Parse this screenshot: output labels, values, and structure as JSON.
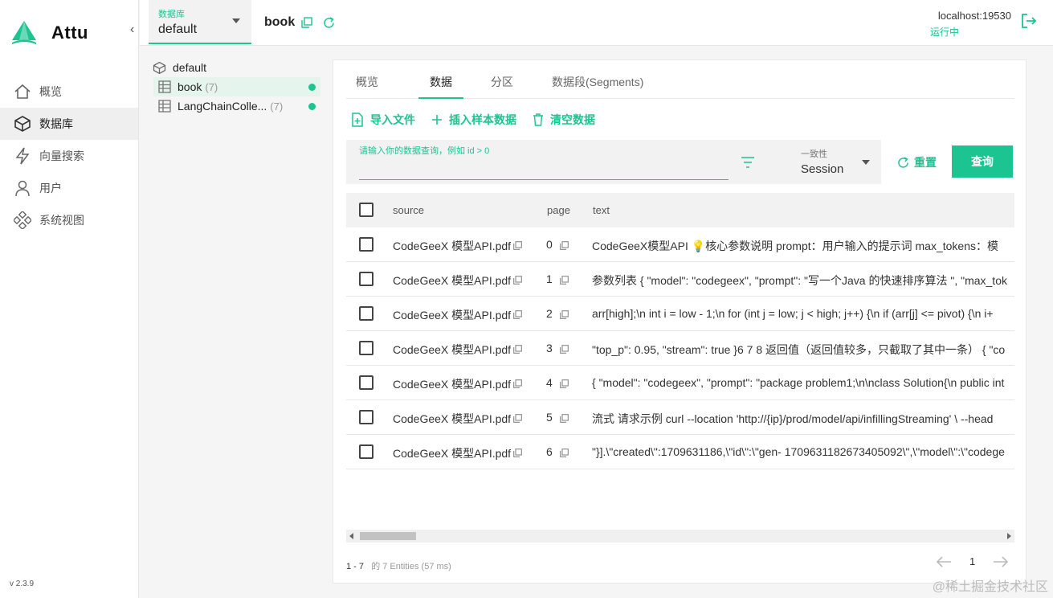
{
  "app": {
    "name": "Attu",
    "version": "v 2.3.9",
    "brand_color": "#1cc492"
  },
  "sidebar": {
    "items": [
      {
        "label": "概览",
        "icon": "home-icon"
      },
      {
        "label": "数据库",
        "icon": "database-icon",
        "active": true
      },
      {
        "label": "向量搜索",
        "icon": "lightning-icon"
      },
      {
        "label": "用户",
        "icon": "user-icon"
      },
      {
        "label": "系统视图",
        "icon": "system-view-icon"
      }
    ]
  },
  "header": {
    "db_label": "数据库",
    "db_value": "default",
    "collection": "book",
    "server": "localhost:19530",
    "status": "运行中"
  },
  "tree": {
    "root": "default",
    "items": [
      {
        "name": "book",
        "count": "(7)"
      },
      {
        "name": "LangChainColle...",
        "count": "(7)"
      }
    ]
  },
  "tabs": [
    "概览",
    "数据",
    "分区",
    "数据段(Segments)"
  ],
  "toolbar": {
    "import": "导入文件",
    "insert_sample": "插入样本数据",
    "clear": "清空数据"
  },
  "query": {
    "placeholder": "请输入你的数据查询，例如 id > 0",
    "consistency_label": "一致性",
    "consistency_value": "Session",
    "reset": "重置",
    "submit": "查询"
  },
  "table": {
    "columns": [
      "source",
      "page",
      "text"
    ],
    "rows": [
      {
        "source": "CodeGeeX 模型API.pdf",
        "page": "0",
        "text": "CodeGeeX󠀠模型API󠀠 💡核心参数说明 prompt：用户输入的提示词󠀠 max_tokens：模"
      },
      {
        "source": "CodeGeeX 模型API.pdf",
        "page": "1",
        "text": "参数列表󠀠 { \"model\": \"codegeex\", \"prompt\": \"写一个Java 的快速排序算法 \", \"max_tok"
      },
      {
        "source": "CodeGeeX 模型API.pdf",
        "page": "2",
        "text": "arr[high];\\n int i = low - 1;\\n for (int j = low; j < high; j++) {\\n if (arr[j] <= pivot) {\\n i+"
      },
      {
        "source": "CodeGeeX 模型API.pdf",
        "page": "3",
        "text": "\"top_p\": 0.95, \"stream\": true }6 7 8 返回值（返回值较多，只截取了其中一条） 󠀠{ \"co"
      },
      {
        "source": "CodeGeeX 模型API.pdf",
        "page": "4",
        "text": "{ \"model\": \"codegeex\", \"prompt\": \"package problem1;\\n\\nclass Solution{\\n public int"
      },
      {
        "source": "CodeGeeX 模型API.pdf",
        "page": "5",
        "text": "流式 请求示例󠀠 curl --location 'http://{ip}/prod/model/api/infillingStreaming' \\ --head"
      },
      {
        "source": "CodeGeeX 模型API.pdf",
        "page": "6",
        "text": "\"}].\\\"created\\\":1709631186,\\\"id\\\":\\\"gen- 1709631182673405092\\\",\\\"model\\\":\\\"codege"
      }
    ]
  },
  "pagination": {
    "range": "1 - 7",
    "summary": "的 7 Entities (57 ms)",
    "page": "1"
  },
  "watermark": "@稀土掘金技术社区"
}
